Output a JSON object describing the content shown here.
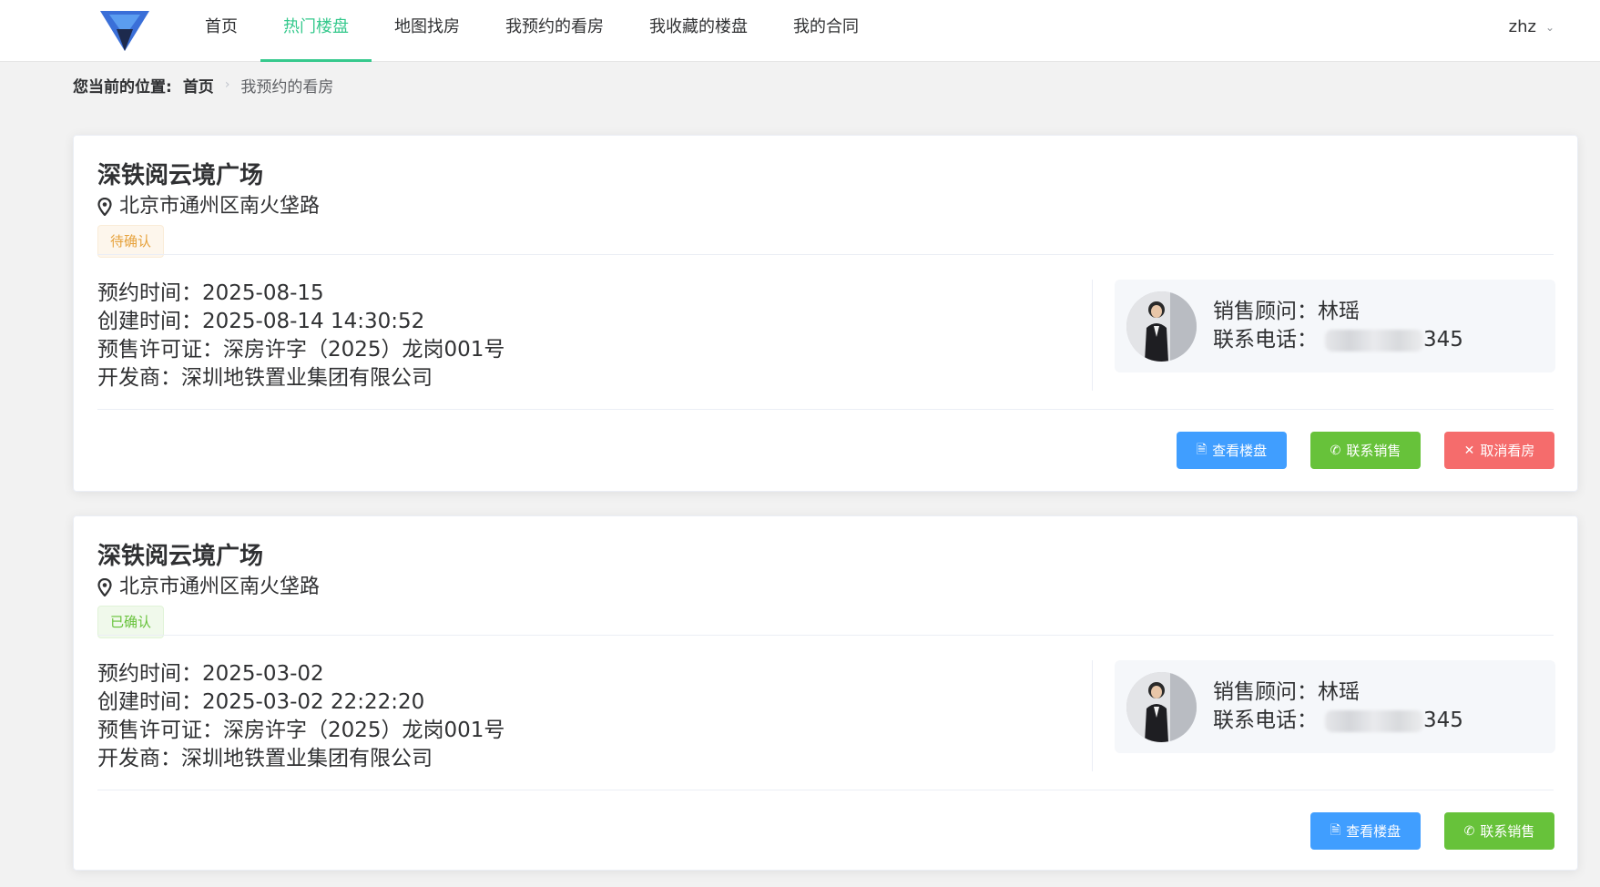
{
  "nav": {
    "items": [
      "首页",
      "热门楼盘",
      "地图找房",
      "我预约的看房",
      "我收藏的楼盘",
      "我的合同"
    ],
    "active_index": 1,
    "user": "zhz"
  },
  "breadcrumb": {
    "label": "您当前的位置:",
    "home": "首页",
    "current": "我预约的看房"
  },
  "appointments": [
    {
      "title": "深铁阅云境广场",
      "address": "北京市通州区南火垡路",
      "status": "待确认",
      "appointment_time": "预约时间：2025-08-15",
      "created_time": "创建时间：2025-08-14 14:30:52",
      "license": "预售许可证：深房许字（2025）龙岗001号",
      "developer": "开发商：深圳地铁置业集团有限公司",
      "sales_name": "销售顾问：林瑶",
      "phone_label": "联系电话：",
      "phone_suffix": "345",
      "buttons": [
        "查看楼盘",
        "联系销售",
        "取消看房"
      ]
    },
    {
      "title": "深铁阅云境广场",
      "address": "北京市通州区南火垡路",
      "status": "已确认",
      "appointment_time": "预约时间：2025-03-02",
      "created_time": "创建时间：2025-03-02 22:22:20",
      "license": "预售许可证：深房许字（2025）龙岗001号",
      "developer": "开发商：深圳地铁置业集团有限公司",
      "sales_name": "销售顾问：林瑶",
      "phone_label": "联系电话：",
      "phone_suffix": "345",
      "buttons": [
        "查看楼盘",
        "联系销售"
      ]
    }
  ],
  "colors": {
    "accent": "#36c98d",
    "primary": "#409eff",
    "success": "#67c23a",
    "danger": "#f56c6c",
    "warning": "#e6a23c"
  },
  "icons": {
    "logo": "triangle-logo",
    "pin": "location-pin-icon",
    "view": "document-icon",
    "phone": "phone-icon",
    "cancel": "close-icon",
    "dropdown": "chevron-down-icon"
  }
}
